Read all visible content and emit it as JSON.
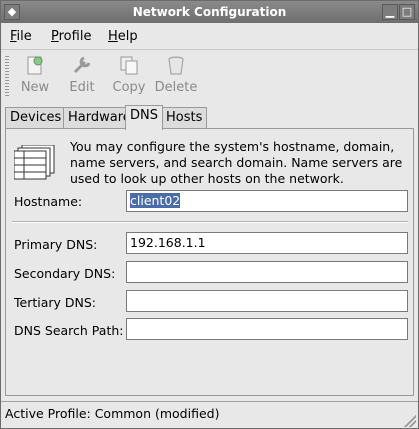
{
  "window": {
    "title": "Network Configuration"
  },
  "menu": [
    {
      "label": "File",
      "underline": "F",
      "rest": "ile"
    },
    {
      "label": "Profile",
      "underline": "P",
      "rest": "rofile"
    },
    {
      "label": "Help",
      "underline": "H",
      "rest": "elp"
    }
  ],
  "toolbar": {
    "new_label": "New",
    "edit_label": "Edit",
    "copy_label": "Copy",
    "delete_label": "Delete"
  },
  "tabs": {
    "devices": "Devices",
    "hardware": "Hardware",
    "dns": "DNS",
    "hosts": "Hosts",
    "active": "DNS"
  },
  "intro": {
    "text": "You may configure the system's hostname, domain, name servers, and search domain. Name servers are used to look up other hosts on the network."
  },
  "form": {
    "hostname_label": "Hostname:",
    "hostname_value": "client02",
    "primary_dns_label": "Primary DNS:",
    "primary_dns_value": "192.168.1.1",
    "secondary_dns_label": "Secondary DNS:",
    "secondary_dns_value": "",
    "tertiary_dns_label": "Tertiary DNS:",
    "tertiary_dns_value": "",
    "search_path_label": "DNS Search Path:",
    "search_path_value": ""
  },
  "status": {
    "text": "Active Profile: Common (modified)"
  }
}
